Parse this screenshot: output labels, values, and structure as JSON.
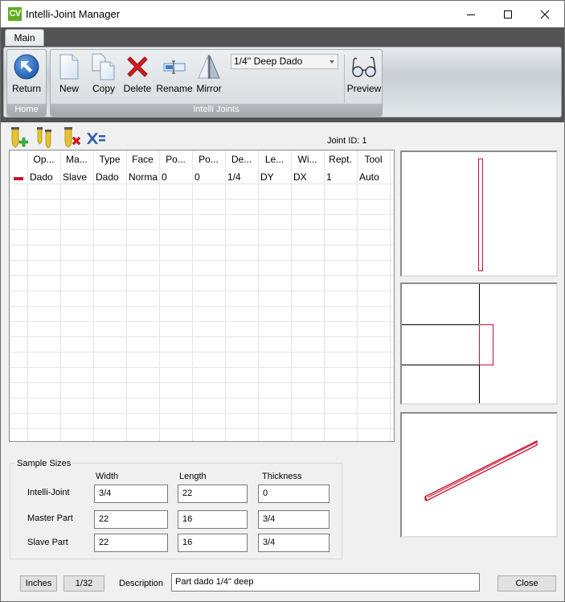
{
  "window": {
    "app_icon_text": "CV",
    "title": "Intelli-Joint Manager",
    "controls": {
      "minimize": "minimize",
      "maximize": "maximize",
      "close": "close"
    }
  },
  "ribbon": {
    "tabs": [
      {
        "label": "Main",
        "active": true
      }
    ],
    "groups": {
      "home": {
        "label": "Home",
        "buttons": [
          {
            "label": "Return",
            "icon": "return-arrow-icon"
          }
        ]
      },
      "joints": {
        "label": "Intelli  Joints",
        "buttons": [
          {
            "label": "New",
            "icon": "new-document-icon"
          },
          {
            "label": "Copy",
            "icon": "copy-icon"
          },
          {
            "label": "Delete",
            "icon": "delete-x-icon"
          },
          {
            "label": "Rename",
            "icon": "rename-icon"
          },
          {
            "label": "Mirror",
            "icon": "mirror-icon"
          },
          {
            "label": "Preview",
            "icon": "glasses-icon"
          }
        ],
        "joint_select": {
          "selected": "1/4'' Deep Dado"
        }
      }
    }
  },
  "toolbar": {
    "icons": [
      {
        "name": "add-operation-icon",
        "tooltip": ""
      },
      {
        "name": "duplicate-operation-icon",
        "tooltip": ""
      },
      {
        "name": "delete-operation-icon",
        "tooltip": ""
      },
      {
        "name": "formula-icon",
        "tooltip": ""
      }
    ],
    "joint_id_label": "Joint ID: 1"
  },
  "grid": {
    "columns": [
      "",
      "Op...",
      "Ma...",
      "Type",
      "Face",
      "Po...",
      "Po...",
      "De...",
      "Le...",
      "Wi...",
      "Rept.",
      "Tool"
    ],
    "rows": [
      [
        "",
        "Dado",
        "Slave",
        "Dado",
        "Norma",
        "0",
        "0",
        "1/4",
        "DY",
        "DX",
        "1",
        "Auto"
      ]
    ]
  },
  "sample_sizes": {
    "legend": "Sample Sizes",
    "columns": [
      "Width",
      "Length",
      "Thickness"
    ],
    "rows": [
      {
        "label": "Intelli-Joint",
        "values": [
          "3/4",
          "22",
          "0"
        ]
      },
      {
        "label": "Master Part",
        "values": [
          "22",
          "16",
          "3/4"
        ]
      },
      {
        "label": "Slave Part",
        "values": [
          "22",
          "16",
          "3/4"
        ]
      }
    ]
  },
  "footer": {
    "units_button": "Inches",
    "precision_button": "1/32",
    "description_label": "Description",
    "description_value": "Part dado 1/4\" deep",
    "close_button": "Close"
  },
  "colors": {
    "accent_red": "#c8102e",
    "ribbon_dark": "#535353",
    "app_icon_green": "#5fae1f"
  }
}
